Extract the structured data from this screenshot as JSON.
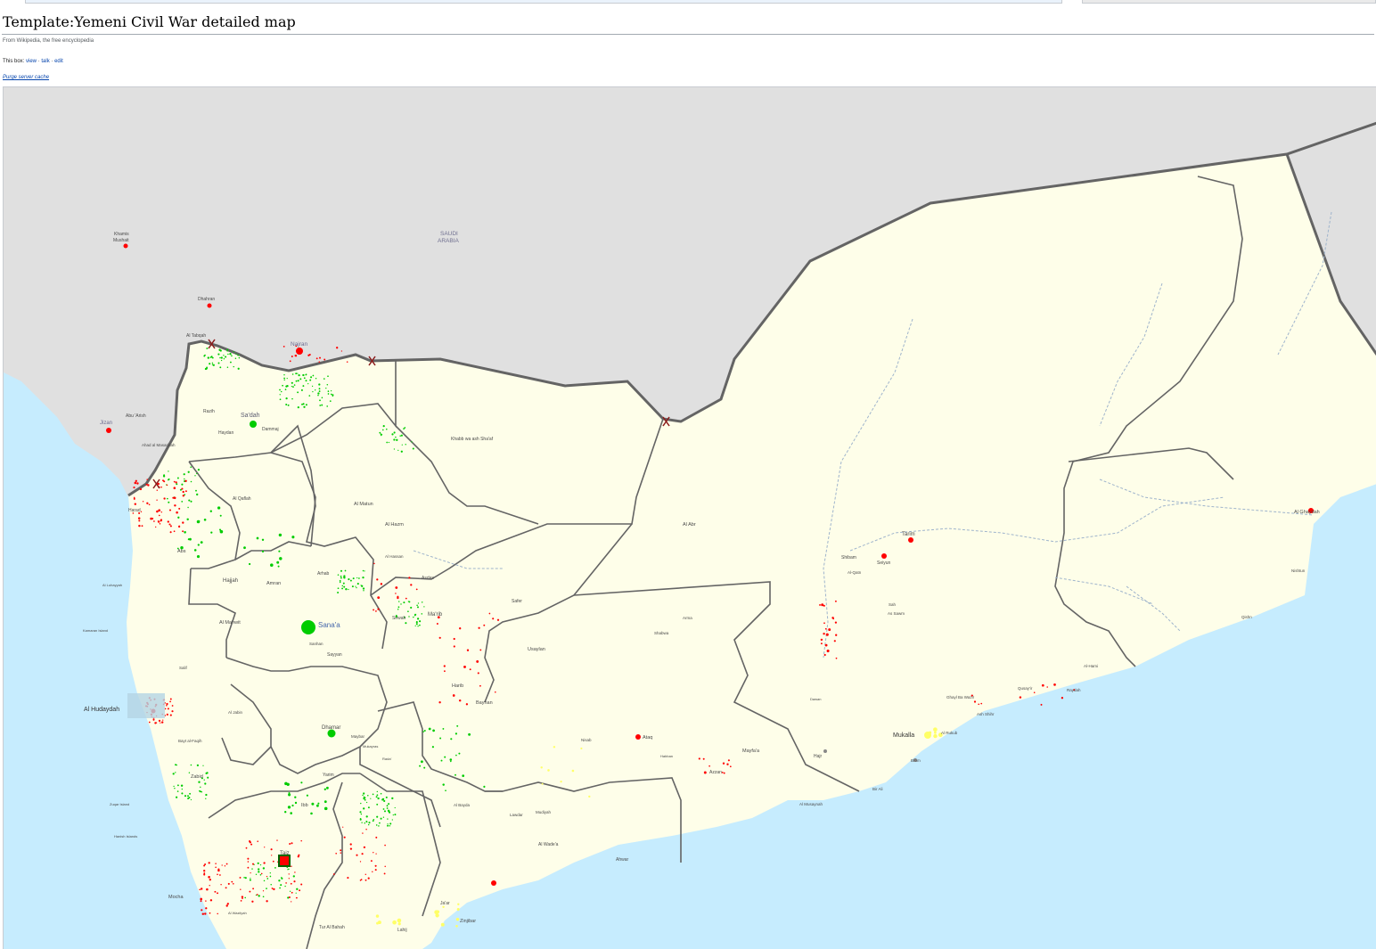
{
  "page": {
    "title": "Template:Yemeni Civil War detailed map",
    "tagline": "From Wikipedia, the free encyclopedia",
    "navbox_prefix": "This box:",
    "nav_view": "view",
    "nav_talk": "talk",
    "nav_edit": "edit",
    "purge_link": "Purge server cache"
  },
  "map": {
    "colors": {
      "sea": "#c6ecfe",
      "land_other": "#e0e0e0",
      "land_yemen": "#fefee9",
      "border": "#646464",
      "governorate_border": "#646464",
      "houthi_control": "#ff0000",
      "government_control": "#00cc00",
      "aqap_control": "#ffff66",
      "river": "#9fb4cc"
    },
    "labels": {
      "country_saudi": "SAUDI\nARABIA",
      "saudi_line1": "SAUDI",
      "saudi_line2": "ARABIA",
      "najran": "Najran",
      "khamis": "Khamis\nMushait",
      "khamis_1": "Khamis",
      "khamis_2": "Mushait",
      "dhahran": "Dhahran",
      "al_tabeqah": "Al Tabqah",
      "jizan": "Jizan",
      "abu_arish": "Abu 'Arish",
      "ahad": "Ahad al Masarihah",
      "saada": "Sa'dah",
      "haydan": "Haydan",
      "dammaj": "Dammaj",
      "razih": "Razih",
      "khabb": "Khabb wa ash Sha'af",
      "al_matun": "Al Matun",
      "al_hazm": "Al Hazm",
      "al_hassan": "Al Hassan",
      "al_qaflah": "Al Qaflah",
      "harad": "Harad",
      "abs": "Abs",
      "hajjah": "Hajjah",
      "amran": "Amran",
      "arhab": "Arhab",
      "al_mahwit": "Al Mahwit",
      "sanaa": "Sana'a",
      "sanhan": "Sanhan",
      "sayyan": "Sayyan",
      "marib": "Ma'rib",
      "sirwah": "Sirwah",
      "safer": "Safer",
      "asdas": "Asdas",
      "al_abr": "Al Abr",
      "al_luhayyah": "Al Luhayyah",
      "kamaran": "Kamaran Island",
      "salif": "Salif",
      "hodeidah": "Al Hudaydah",
      "al_jabin": "Al Jabin",
      "dhamar": "Dhamar",
      "maybar": "Maybar",
      "mukayras": "Mukayras",
      "rada": "Rada'",
      "yarim": "Yarim",
      "ibb": "Ibb",
      "zabid": "Zabid",
      "bayt_al_faqih": "Bayt al-Faqih",
      "taiz": "Taiz",
      "mocha": "Mocha",
      "zuqar": "Zuqar Island",
      "hanish": "Hanish Islands",
      "al_bayda": "Al Bayda",
      "lawdar": "Lawdar",
      "mudiyah": "Mudiyah",
      "zinjibar": "Zinjibar",
      "jaar": "Ja'ar",
      "aden": "Aden",
      "lahij": "Lahij",
      "tur_al_bahah": "Tur Al Bahah",
      "al_waziiyah": "Al Waziiyah",
      "harib": "Harib",
      "bayhan": "Bayhan",
      "usaylan": "Usaylan",
      "ataq": "Ataq",
      "nisab": "Nisab",
      "azzan": "Azzan",
      "habban": "Habban",
      "mayfaa": "Mayfa'a",
      "ahwar": "Ahwar",
      "al_wadea": "Al Wade'a",
      "shabwa": "Shabwa",
      "arma": "Arma",
      "mukalla": "Mukalla",
      "al_rukub": "Al Rukub",
      "burum": "Brom",
      "ash_shihr": "Ash Shihr",
      "ghayl_ba_wazir": "Ghayl Ba Wazir",
      "hajr": "Hajr",
      "tarim": "Tarim",
      "seiyun": "Seiyun",
      "shibam": "Shibam",
      "al_qatn": "Al-Qatn",
      "sah": "Sah",
      "al_qaydah": "Al Ghaydah",
      "nishtun": "Nishtun",
      "qishn": "Qishn",
      "al_hamiyah": "Al-Hami",
      "qusayir": "Qusay'ir",
      "raydah": "Raydah",
      "al_sawm": "As Sawm",
      "dawan": "Dawan",
      "bir_ali": "Bir Ali",
      "al_abr_2": "Al Abr",
      "al_mukalla_region": "Al Musaynah"
    }
  }
}
